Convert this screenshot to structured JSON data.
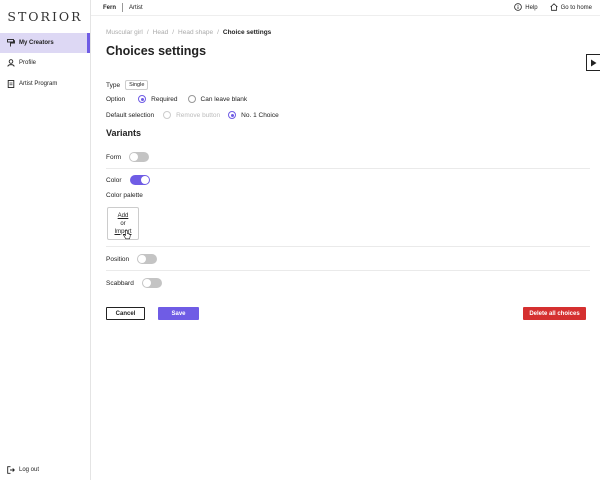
{
  "sidebar": {
    "logo": "STORIOR",
    "items": [
      {
        "label": "My Creators",
        "icon": "paint-roller-icon",
        "active": true
      },
      {
        "label": "Profile",
        "icon": "person-icon",
        "active": false
      },
      {
        "label": "Artist Program",
        "icon": "document-icon",
        "active": false
      }
    ],
    "logout": "Log out"
  },
  "topbar": {
    "user": "Fern",
    "role": "Artist",
    "help": "Help",
    "home": "Go to home"
  },
  "breadcrumb": [
    "Muscular girl",
    "Head",
    "Head shape",
    "Choice settings"
  ],
  "page_title": "Choices settings",
  "settings": {
    "type_label": "Type",
    "type_value": "Single",
    "option_label": "Option",
    "option_required": "Required",
    "option_blank": "Can leave blank",
    "default_label": "Default selection",
    "default_remove": "Remove button",
    "default_choice": "No. 1 Choice"
  },
  "variants": {
    "title": "Variants",
    "form": {
      "label": "Form",
      "on": false
    },
    "color": {
      "label": "Color",
      "on": true
    },
    "palette_label": "Color palette",
    "palette_add": "Add",
    "palette_or": "or",
    "palette_import": "Import",
    "position": {
      "label": "Position",
      "on": false
    },
    "scabbard": {
      "label": "Scabbard",
      "on": false
    }
  },
  "actions": {
    "cancel": "Cancel",
    "save": "Save",
    "delete_all": "Delete all choices"
  },
  "colors": {
    "accent": "#6f5ce5",
    "active_nav": "#ddd8f4",
    "danger": "#d53030"
  }
}
